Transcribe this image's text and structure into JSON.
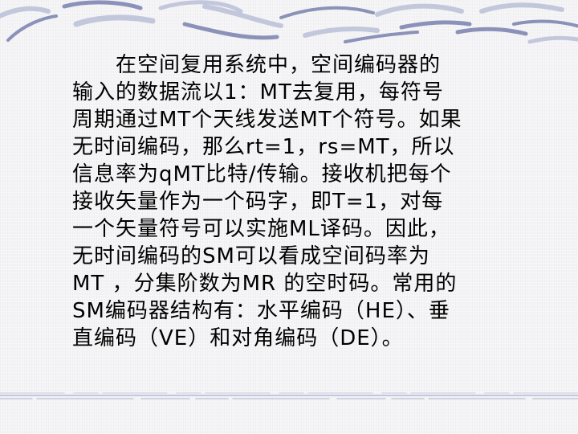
{
  "slide": {
    "body_text": "　　在空间复用系统中，空间编码器的\n输入的数据流以1：MT去复用，每符号\n周期通过MT个天线发送MT个符号。如果\n无时间编码，那么rt=1，rs=MT，所以\n信息率为qMT比特/传输。接收机把每个\n接收矢量作为一个码字，即T=1，对每\n一个矢量符号可以实施ML译码。因此，\n无时间编码的SM可以看成空间码率为\nMT ，分集阶数为MR 的空时码。常用的\nSM编码器结构有：水平编码（HE）、垂\n直编码（VE）和对角编码（DE）。"
  },
  "colors": {
    "stroke_dark": "#8b91b8",
    "stroke_light": "#c3c7dc",
    "background": "#f4f4f6"
  }
}
